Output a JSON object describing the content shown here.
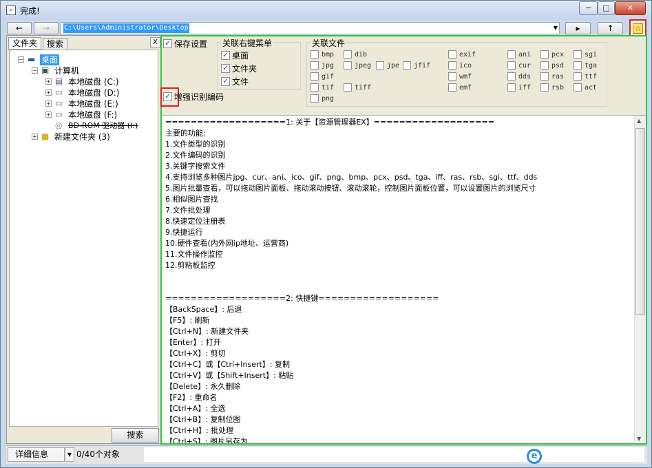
{
  "window": {
    "title": "完成!",
    "icon": "magnifier-icon",
    "controls": {
      "minimize": "─",
      "maximize": "□",
      "close": "✕"
    }
  },
  "toolbar": {
    "back_label": "←",
    "forward_label": "→",
    "address_value": "C:\\Users\\Administrator\\Desktop",
    "address_dropdown": "▼",
    "go_label": "▸",
    "up_label": "↑",
    "favorite_icon": "star-icon",
    "favorite_symbol": "☆"
  },
  "left_panel": {
    "tabs": [
      "文件夹",
      "搜索"
    ],
    "close_label": "X",
    "tree": [
      {
        "label": "桌面",
        "icon": "desktop-icon",
        "expander": "−",
        "selected": true
      },
      {
        "label": "计算机",
        "icon": "computer-icon",
        "expander": "−"
      },
      {
        "label": "本地磁盘 (C:)",
        "icon": "system-drive-icon",
        "expander": "+"
      },
      {
        "label": "本地磁盘 (D:)",
        "icon": "drive-icon",
        "expander": "+"
      },
      {
        "label": "本地磁盘 (E:)",
        "icon": "drive-icon",
        "expander": "+"
      },
      {
        "label": "本地磁盘 (F:)",
        "icon": "drive-icon",
        "expander": "+"
      },
      {
        "label": "BD-ROM 驱动器 (I:)",
        "icon": "disc-drive-icon",
        "expander": ""
      },
      {
        "label": "新建文件夹 (3)",
        "icon": "folder-icon",
        "expander": "+"
      }
    ],
    "search_button": "搜索"
  },
  "options": {
    "save_settings": {
      "label": "保存设置",
      "checked": true
    },
    "enhanced_encoding": {
      "label": "增强识别编码",
      "checked": true
    },
    "context_menu": {
      "title": "关联右键菜单",
      "items": [
        {
          "label": "桌面",
          "checked": true
        },
        {
          "label": "文件夹",
          "checked": true
        },
        {
          "label": "文件",
          "checked": true
        }
      ]
    },
    "file_assoc": {
      "title": "关联文件",
      "types": [
        "bmp",
        "dib",
        "jpg",
        "jpeg",
        "jpe",
        "jfif",
        "gif",
        "tif",
        "tiff",
        "png",
        "exif",
        "ico",
        "wmf",
        "emf",
        "ani",
        "cur",
        "dds",
        "iff",
        "pcx",
        "psd",
        "ras",
        "rsb",
        "sgi",
        "tga",
        "ttf",
        "act"
      ]
    }
  },
  "content": {
    "lines": [
      "===================1: 关于【资源管理器EX】===================",
      "主要的功能:",
      "          1.文件类型的识别",
      "          2.文件编码的识别",
      "          3.关键字搜索文件",
      "          4.支持浏览多种图片jpg、cur、ani、ico、gif、png、bmp、pcx、psd、tga、iff、ras、rsb、sgi、ttf、dds",
      "          5.图片批量查看，可以拖动图片面板、拖动滚动按钮、滚动滚轮，控制图片面板位置，可以设置图片的浏览尺寸",
      "          6.相似图片查找",
      "          7.文件批处理",
      "          8.快速定位注册表",
      "          9.快捷运行",
      "          10.硬件查看(内外网ip地址、运营商)",
      "          11.文件操作监控",
      "          12.剪粘板监控",
      "",
      "",
      "===================2: 快捷键===================",
      "【BackSpace】: 后退",
      "【F5】: 刷新",
      "【Ctrl+N】: 新建文件夹",
      "【Enter】: 打开",
      "【Ctrl+X】: 剪切",
      "【Ctrl+C】或【Ctrl+Insert】: 复制",
      "【Ctrl+V】或【Shift+Insert】: 粘贴",
      "【Delete】: 永久删除",
      "【F2】: 重命名",
      "【Ctrl+A】: 全选",
      "【Ctrl+B】: 复制位图",
      "【Ctrl+H】: 批处理",
      "【Ctrl+S】: 图片另存为"
    ]
  },
  "status_bar": {
    "view_mode": "详细信息",
    "view_dropdown": "▼",
    "object_count": "0/40个对象",
    "browser_icon": "ie-icon",
    "browser_glyph": "e"
  },
  "colors": {
    "highlight_border": "#30c840",
    "annotation_box": "#e02020",
    "selection": "#3399ff"
  }
}
